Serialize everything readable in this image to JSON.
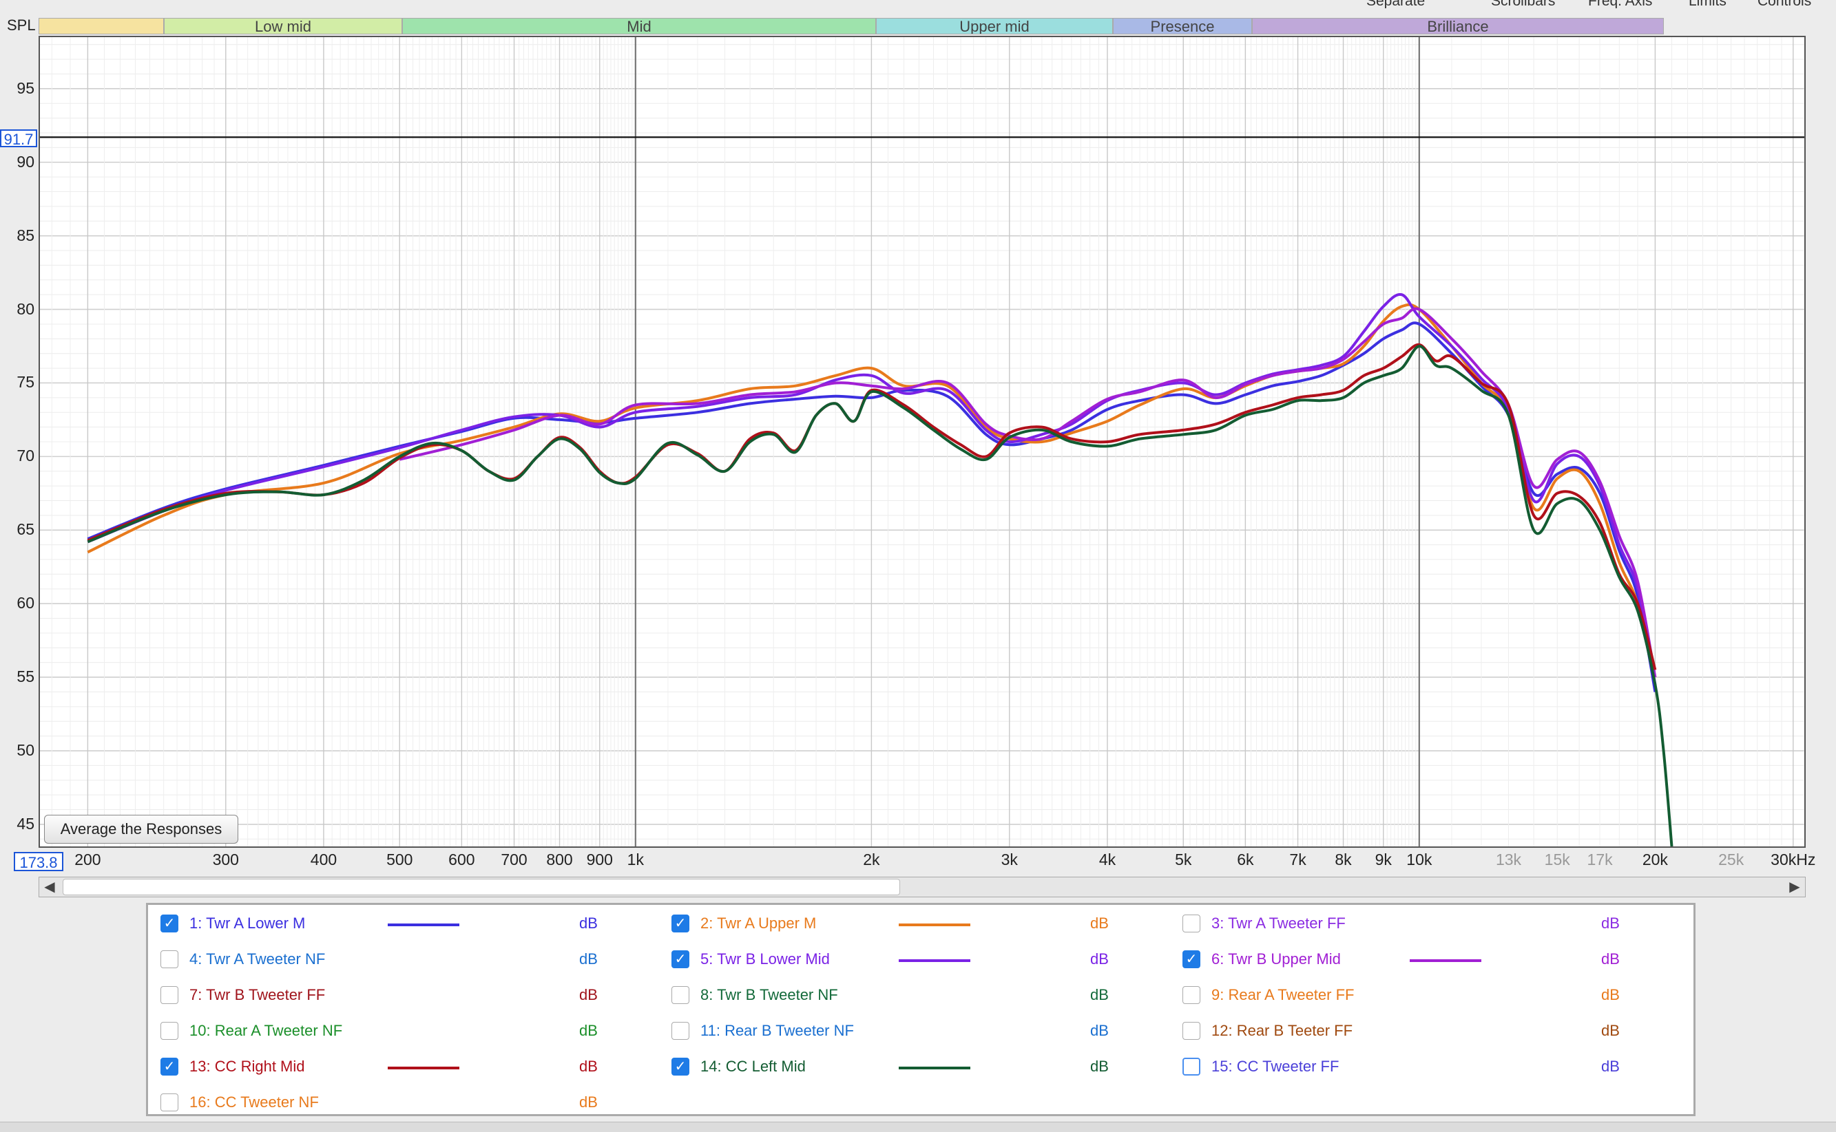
{
  "top_menu": [
    "Separate",
    "Scrollbars",
    "Freq. Axis",
    "Limits",
    "Controls"
  ],
  "spl_label": "SPL",
  "bands": [
    "",
    "Low mid",
    "Mid",
    "Upper mid",
    "Presence",
    "Brilliance"
  ],
  "band_colors": [
    "#f6e3a0",
    "#d2eda6",
    "#9ee3ac",
    "#9bdede",
    "#a9b9e6",
    "#bfa8d9"
  ],
  "y_ticks": [
    95,
    90,
    85,
    80,
    75,
    70,
    65,
    60,
    55,
    50,
    45
  ],
  "x_ticks": [
    {
      "v": 200,
      "label": "200"
    },
    {
      "v": 300,
      "label": "300"
    },
    {
      "v": 400,
      "label": "400"
    },
    {
      "v": 500,
      "label": "500"
    },
    {
      "v": 600,
      "label": "600"
    },
    {
      "v": 700,
      "label": "700"
    },
    {
      "v": 800,
      "label": "800"
    },
    {
      "v": 900,
      "label": "900"
    },
    {
      "v": 1000,
      "label": "1k"
    },
    {
      "v": 2000,
      "label": "2k"
    },
    {
      "v": 3000,
      "label": "3k"
    },
    {
      "v": 4000,
      "label": "4k"
    },
    {
      "v": 5000,
      "label": "5k"
    },
    {
      "v": 6000,
      "label": "6k"
    },
    {
      "v": 7000,
      "label": "7k"
    },
    {
      "v": 8000,
      "label": "8k"
    },
    {
      "v": 9000,
      "label": "9k"
    },
    {
      "v": 10000,
      "label": "10k"
    },
    {
      "v": 13000,
      "label": "13k",
      "minor": true
    },
    {
      "v": 15000,
      "label": "15k",
      "minor": true
    },
    {
      "v": 17000,
      "label": "17k",
      "minor": true
    },
    {
      "v": 20000,
      "label": "20k"
    },
    {
      "v": 25000,
      "label": "25k",
      "minor": true
    },
    {
      "v": 30000,
      "label": "30kHz"
    }
  ],
  "cursor": {
    "y_readout": "91.7",
    "x_readout": "173.8"
  },
  "average_button": "Average the Responses",
  "legend": [
    {
      "label": "1: Twr A Lower M",
      "checked": true,
      "color": "#3b2fe0",
      "unit": "dB"
    },
    {
      "label": "2: Twr A Upper M",
      "checked": true,
      "color": "#e87a1c",
      "unit": "dB"
    },
    {
      "label": "3: Twr A Tweeter FF",
      "checked": false,
      "color": "#8a2be2",
      "unit": "dB"
    },
    {
      "label": "4: Twr A Tweeter NF",
      "checked": false,
      "color": "#1a6fd0",
      "unit": "dB"
    },
    {
      "label": "5: Twr B Lower Mid",
      "checked": true,
      "color": "#7a22e6",
      "unit": "dB"
    },
    {
      "label": "6: Twr B Upper Mid",
      "checked": true,
      "color": "#a11fd4",
      "unit": "dB"
    },
    {
      "label": "7: Twr B Tweeter FF",
      "checked": false,
      "color": "#a0141c",
      "unit": "dB"
    },
    {
      "label": "8: Twr B Tweeter NF",
      "checked": false,
      "color": "#136a3a",
      "unit": "dB"
    },
    {
      "label": "9: Rear A Tweeter FF",
      "checked": false,
      "color": "#e87a1c",
      "unit": "dB"
    },
    {
      "label": "10: Rear A Tweeter NF",
      "checked": false,
      "color": "#1b8f2a",
      "unit": "dB"
    },
    {
      "label": "11: Rear B Tweeter NF",
      "checked": false,
      "color": "#1a6fd0",
      "unit": "dB"
    },
    {
      "label": "12: Rear B Teeter FF",
      "checked": false,
      "color": "#a04a10",
      "unit": "dB"
    },
    {
      "label": "13: CC Right Mid",
      "checked": true,
      "color": "#b0101a",
      "unit": "dB"
    },
    {
      "label": "14: CC Left Mid",
      "checked": true,
      "color": "#135c32",
      "unit": "dB"
    },
    {
      "label": "15: CC Tweeter FF",
      "checked": false,
      "focused": true,
      "color": "#4a3fd8",
      "unit": "dB"
    },
    {
      "label": "16: CC Tweeter NF",
      "checked": false,
      "color": "#e87a1c",
      "unit": "dB"
    }
  ],
  "chart_data": {
    "type": "line",
    "xlabel": "",
    "ylabel": "SPL",
    "x_scale": "log",
    "xlim": [
      173.8,
      31000
    ],
    "ylim": [
      43.5,
      98.5
    ],
    "cursor_spl": 91.7,
    "series": [
      {
        "name": "1: Twr A Lower M",
        "color": "#3b2fe0",
        "x": [
          200,
          250,
          300,
          400,
          500,
          600,
          700,
          800,
          900,
          1000,
          1200,
          1400,
          1600,
          1800,
          2000,
          2200,
          2500,
          2800,
          3000,
          3300,
          3600,
          4000,
          4400,
          5000,
          5500,
          6000,
          6500,
          7000,
          7500,
          8000,
          8500,
          9000,
          9500,
          10000,
          11000,
          12000,
          13000,
          14000,
          15000,
          16000,
          17000,
          18000,
          19000,
          20000
        ],
        "y": [
          64.4,
          66.5,
          67.8,
          69.4,
          70.7,
          71.7,
          72.6,
          72.5,
          72.3,
          72.6,
          73.0,
          73.6,
          73.9,
          74.1,
          74.0,
          74.5,
          74.1,
          71.5,
          70.8,
          71.2,
          71.8,
          73.2,
          73.8,
          74.2,
          73.6,
          74.2,
          74.8,
          75.1,
          75.5,
          76.2,
          77.0,
          78.0,
          78.6,
          79.0,
          77.0,
          74.8,
          72.8,
          67.5,
          68.8,
          69.2,
          67.5,
          63.6,
          60.5,
          54.0
        ]
      },
      {
        "name": "2: Twr A Upper M",
        "color": "#e87a1c",
        "x": [
          200,
          250,
          300,
          400,
          500,
          600,
          700,
          800,
          900,
          1000,
          1200,
          1400,
          1600,
          1800,
          2000,
          2200,
          2500,
          2800,
          3000,
          3300,
          3600,
          4000,
          4400,
          5000,
          5500,
          6000,
          6500,
          7000,
          7500,
          8000,
          8500,
          9000,
          9500,
          10000,
          11000,
          12000,
          13000,
          14000,
          15000,
          16000,
          17000,
          18000,
          19000,
          20000
        ],
        "y": [
          63.5,
          66.0,
          67.4,
          68.2,
          70.2,
          71.1,
          72.0,
          72.9,
          72.4,
          73.3,
          73.8,
          74.6,
          74.8,
          75.5,
          76.0,
          74.8,
          74.8,
          72.0,
          71.2,
          71.0,
          71.6,
          72.4,
          73.5,
          74.6,
          74.0,
          74.8,
          75.5,
          75.8,
          76.0,
          76.3,
          77.5,
          79.2,
          80.2,
          80.0,
          77.5,
          75.0,
          73.0,
          66.5,
          68.5,
          69.0,
          66.8,
          62.8,
          60.0,
          55.0
        ]
      },
      {
        "name": "5: Twr B Lower Mid",
        "color": "#7a22e6",
        "x": [
          200,
          250,
          300,
          400,
          500,
          600,
          700,
          800,
          900,
          1000,
          1200,
          1400,
          1600,
          1800,
          2000,
          2200,
          2500,
          2800,
          3000,
          3300,
          3600,
          4000,
          4400,
          5000,
          5500,
          6000,
          6500,
          7000,
          7500,
          8000,
          8500,
          9000,
          9500,
          10000,
          11000,
          12000,
          13000,
          14000,
          15000,
          16000,
          17000,
          18000,
          19000,
          20000
        ],
        "y": [
          64.2,
          66.3,
          67.7,
          69.3,
          70.6,
          71.8,
          72.7,
          72.8,
          72.0,
          73.0,
          73.4,
          74.0,
          74.2,
          75.2,
          75.5,
          74.3,
          74.5,
          71.8,
          71.0,
          71.5,
          72.2,
          73.8,
          74.5,
          75.0,
          74.2,
          75.0,
          75.6,
          75.9,
          76.2,
          76.8,
          78.5,
          80.2,
          81.0,
          79.5,
          77.5,
          75.3,
          73.2,
          67.0,
          69.5,
          70.0,
          68.0,
          64.0,
          61.0,
          54.5
        ]
      },
      {
        "name": "6: Twr B Upper Mid",
        "color": "#a11fd4",
        "x": [
          500,
          600,
          700,
          800,
          900,
          1000,
          1200,
          1400,
          1600,
          1800,
          2000,
          2200,
          2500,
          2800,
          3000,
          3300,
          3600,
          4000,
          4400,
          5000,
          5500,
          6000,
          6500,
          7000,
          7500,
          8000,
          8500,
          9000,
          9500,
          10000,
          11000,
          12000,
          13000,
          14000,
          15000,
          16000,
          17000,
          18000,
          19000,
          20000
        ],
        "y": [
          69.8,
          70.8,
          71.8,
          72.8,
          72.2,
          73.5,
          73.6,
          74.2,
          74.4,
          75.0,
          74.8,
          74.6,
          75.0,
          72.2,
          71.4,
          71.2,
          72.4,
          73.9,
          74.4,
          75.2,
          74.0,
          74.9,
          75.5,
          75.8,
          76.0,
          76.6,
          77.8,
          79.0,
          79.4,
          80.0,
          78.0,
          75.8,
          73.5,
          68.0,
          69.8,
          70.3,
          68.3,
          64.6,
          61.5,
          55.0
        ]
      },
      {
        "name": "13: CC Right Mid",
        "color": "#b0101a",
        "x": [
          200,
          250,
          300,
          350,
          400,
          450,
          500,
          550,
          600,
          650,
          700,
          750,
          800,
          850,
          900,
          950,
          1000,
          1100,
          1200,
          1300,
          1400,
          1500,
          1600,
          1700,
          1800,
          1900,
          2000,
          2200,
          2400,
          2600,
          2800,
          3000,
          3300,
          3600,
          4000,
          4400,
          5000,
          5500,
          6000,
          6500,
          7000,
          7500,
          8000,
          8500,
          9000,
          9500,
          10000,
          10500,
          11000,
          12000,
          13000,
          14000,
          15000,
          16000,
          17000,
          18000,
          19000,
          20000
        ],
        "y": [
          64.3,
          66.4,
          67.5,
          67.6,
          67.4,
          68.2,
          69.9,
          70.8,
          70.4,
          69.0,
          68.5,
          70.0,
          71.3,
          70.6,
          69.0,
          68.2,
          68.6,
          70.8,
          70.2,
          69.0,
          71.2,
          71.6,
          70.4,
          72.8,
          73.6,
          72.4,
          74.5,
          73.5,
          72.0,
          70.8,
          70.0,
          71.6,
          72.0,
          71.2,
          71.0,
          71.5,
          71.8,
          72.2,
          73.0,
          73.5,
          74.0,
          74.2,
          74.5,
          75.5,
          76.0,
          76.8,
          77.6,
          76.5,
          76.8,
          75.0,
          73.5,
          66.0,
          67.5,
          67.3,
          65.5,
          62.0,
          60.0,
          55.5
        ]
      },
      {
        "name": "14: CC Left Mid",
        "color": "#135c32",
        "x": [
          200,
          250,
          300,
          350,
          400,
          450,
          500,
          550,
          600,
          650,
          700,
          750,
          800,
          850,
          900,
          950,
          1000,
          1100,
          1200,
          1300,
          1400,
          1500,
          1600,
          1700,
          1800,
          1900,
          2000,
          2200,
          2400,
          2600,
          2800,
          3000,
          3300,
          3600,
          4000,
          4400,
          5000,
          5500,
          6000,
          6500,
          7000,
          7500,
          8000,
          8500,
          9000,
          9500,
          10000,
          10500,
          11000,
          12000,
          13000,
          14000,
          15000,
          16000,
          17000,
          18000,
          19000,
          20000,
          20500,
          21000
        ],
        "y": [
          64.2,
          66.3,
          67.4,
          67.6,
          67.4,
          68.4,
          70.0,
          70.9,
          70.4,
          69.0,
          68.4,
          70.0,
          71.2,
          70.5,
          68.9,
          68.2,
          68.5,
          70.9,
          70.1,
          69.0,
          71.0,
          71.5,
          70.3,
          72.8,
          73.6,
          72.4,
          74.4,
          73.3,
          71.8,
          70.5,
          69.8,
          71.3,
          71.8,
          71.0,
          70.7,
          71.2,
          71.5,
          71.8,
          72.8,
          73.2,
          73.8,
          73.8,
          74.0,
          75.0,
          75.5,
          76.0,
          77.5,
          76.2,
          76.0,
          74.5,
          72.8,
          65.0,
          66.8,
          67.0,
          65.0,
          61.8,
          59.5,
          54.5,
          50.0,
          43.5
        ]
      }
    ]
  }
}
